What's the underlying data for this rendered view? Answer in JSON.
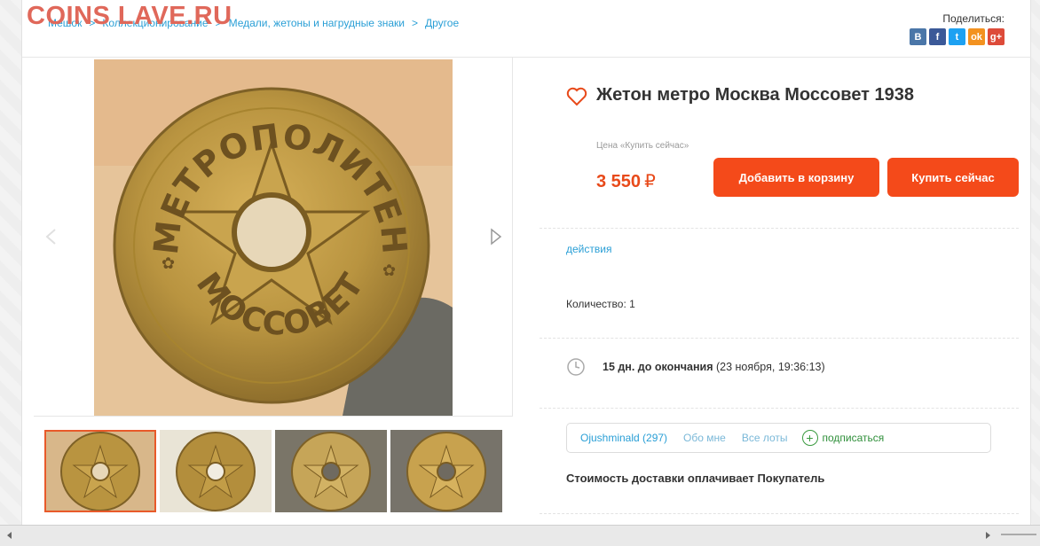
{
  "watermark": "COINS LAVE.RU",
  "breadcrumb": {
    "items": [
      "Мешок",
      "Коллекционирование",
      "Медали, жетоны и нагрудные знаки",
      "Другое"
    ],
    "separator": ">"
  },
  "share": {
    "label": "Поделиться:",
    "icons": [
      {
        "name": "vk-icon",
        "glyph": "В",
        "color": "#4a76a8"
      },
      {
        "name": "facebook-icon",
        "glyph": "f",
        "color": "#3b5998"
      },
      {
        "name": "twitter-icon",
        "glyph": "t",
        "color": "#1da1f2"
      },
      {
        "name": "odnoklassniki-icon",
        "glyph": "ok",
        "color": "#f39220"
      },
      {
        "name": "google-plus-icon",
        "glyph": "g+",
        "color": "#dd4b39"
      }
    ]
  },
  "coin": {
    "top_text": "МЕТРОПОЛИТЕН",
    "bottom_text": "МОССОВЕТ"
  },
  "product": {
    "title": "Жетон метро Москва Моссовет 1938",
    "price_label": "Цена «Купить сейчас»",
    "price": "3 550",
    "currency": "₽",
    "add_to_cart": "Добавить в корзину",
    "buy_now": "Купить сейчас",
    "actions": "действия",
    "quantity": "Количество: 1",
    "time_left": "15 дн. до окончания",
    "end_date": "(23 ноября, 19:36:13)",
    "delivery": "Стоимость доставки оплачивает Покупатель"
  },
  "seller": {
    "name": "Ojushminald (297)",
    "about": "Обо мне",
    "all_lots": "Все лоты",
    "subscribe": "подписаться"
  },
  "colors": {
    "accent": "#f44a1a",
    "link": "#2a9fd6",
    "price": "#e84a1a"
  }
}
